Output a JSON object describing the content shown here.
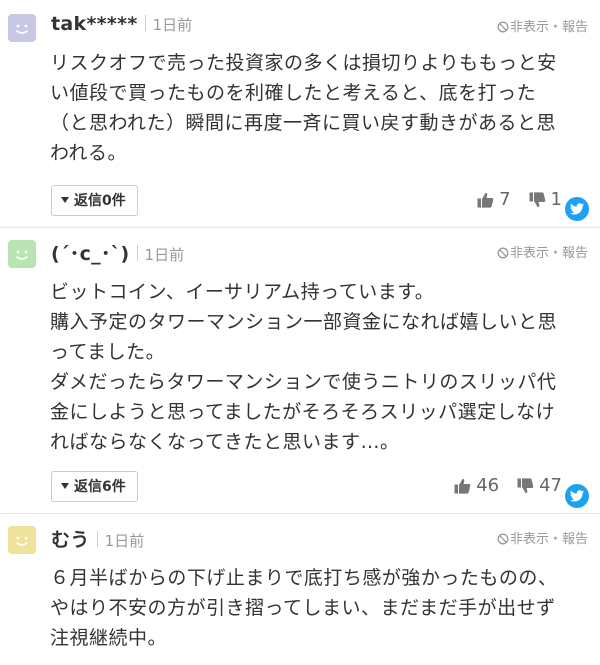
{
  "comments": [
    {
      "user": "tak*****",
      "time": "1日前",
      "avatar_color": "#c7c7e8",
      "report": {
        "hide": "非表示",
        "dot": "・",
        "report": "報告"
      },
      "body": [
        "リスクオフで売った投資家の多くは損切りよりももっと安",
        "い値段で買ったものを利確したと考えると、底を打った",
        "（と思われた）瞬間に再度一斉に買い戻す動きがあると思",
        "われる。"
      ],
      "reply_label": "返信0件",
      "likes": "7",
      "dislikes": "1"
    },
    {
      "user": "(´･c_･`)",
      "time": "1日前",
      "avatar_color": "#b9e3b2",
      "report": {
        "hide": "非表示",
        "dot": "・",
        "report": "報告"
      },
      "body": [
        "ビットコイン、イーサリアム持っています。",
        "購入予定のタワーマンション一部資金になれば嬉しいと思",
        "ってました。",
        "ダメだったらタワーマンションで使うニトリのスリッパ代",
        "金にしようと思ってましたがそろそろスリッパ選定しなけ",
        "ればならなくなってきたと思います…。"
      ],
      "reply_label": "返信6件",
      "likes": "46",
      "dislikes": "47"
    },
    {
      "user": "むう",
      "time": "1日前",
      "avatar_color": "#efe29a",
      "report": {
        "hide": "非表示",
        "dot": "・",
        "report": "報告"
      },
      "body": [
        "６月半ばからの下げ止まりで底打ち感が強かったものの、",
        "やはり不安の方が引き摺ってしまい、まだまだ手が出せず",
        "注視継続中。"
      ]
    }
  ],
  "colors": {
    "twitter": "#1da1f2",
    "muted": "#999999",
    "divider": "#e6e6e6"
  },
  "icons": {
    "avatar": "smiley-avatar-icon",
    "report": "prohibited-icon",
    "reply": "caret-down-icon",
    "like": "thumbs-up-icon",
    "dislike": "thumbs-down-icon",
    "share": "twitter-bird-icon"
  }
}
